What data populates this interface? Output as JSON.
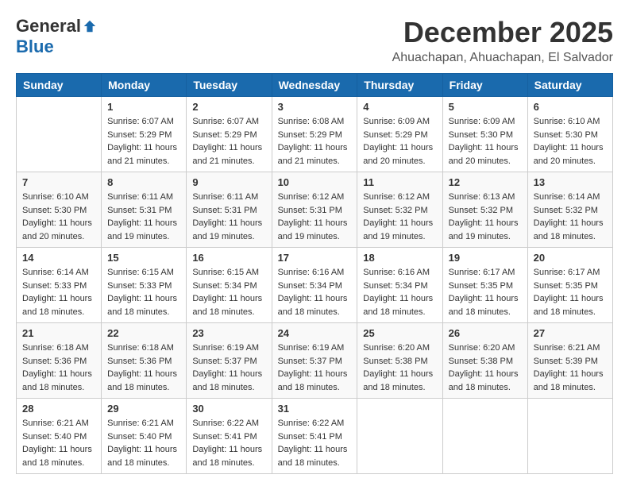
{
  "logo": {
    "general": "General",
    "blue": "Blue"
  },
  "title": {
    "month": "December 2025",
    "location": "Ahuachapan, Ahuachapan, El Salvador"
  },
  "headers": [
    "Sunday",
    "Monday",
    "Tuesday",
    "Wednesday",
    "Thursday",
    "Friday",
    "Saturday"
  ],
  "weeks": [
    [
      {
        "day": "",
        "sunrise": "",
        "sunset": "",
        "daylight": ""
      },
      {
        "day": "1",
        "sunrise": "Sunrise: 6:07 AM",
        "sunset": "Sunset: 5:29 PM",
        "daylight": "Daylight: 11 hours and 21 minutes."
      },
      {
        "day": "2",
        "sunrise": "Sunrise: 6:07 AM",
        "sunset": "Sunset: 5:29 PM",
        "daylight": "Daylight: 11 hours and 21 minutes."
      },
      {
        "day": "3",
        "sunrise": "Sunrise: 6:08 AM",
        "sunset": "Sunset: 5:29 PM",
        "daylight": "Daylight: 11 hours and 21 minutes."
      },
      {
        "day": "4",
        "sunrise": "Sunrise: 6:09 AM",
        "sunset": "Sunset: 5:29 PM",
        "daylight": "Daylight: 11 hours and 20 minutes."
      },
      {
        "day": "5",
        "sunrise": "Sunrise: 6:09 AM",
        "sunset": "Sunset: 5:30 PM",
        "daylight": "Daylight: 11 hours and 20 minutes."
      },
      {
        "day": "6",
        "sunrise": "Sunrise: 6:10 AM",
        "sunset": "Sunset: 5:30 PM",
        "daylight": "Daylight: 11 hours and 20 minutes."
      }
    ],
    [
      {
        "day": "7",
        "sunrise": "Sunrise: 6:10 AM",
        "sunset": "Sunset: 5:30 PM",
        "daylight": "Daylight: 11 hours and 20 minutes."
      },
      {
        "day": "8",
        "sunrise": "Sunrise: 6:11 AM",
        "sunset": "Sunset: 5:31 PM",
        "daylight": "Daylight: 11 hours and 19 minutes."
      },
      {
        "day": "9",
        "sunrise": "Sunrise: 6:11 AM",
        "sunset": "Sunset: 5:31 PM",
        "daylight": "Daylight: 11 hours and 19 minutes."
      },
      {
        "day": "10",
        "sunrise": "Sunrise: 6:12 AM",
        "sunset": "Sunset: 5:31 PM",
        "daylight": "Daylight: 11 hours and 19 minutes."
      },
      {
        "day": "11",
        "sunrise": "Sunrise: 6:12 AM",
        "sunset": "Sunset: 5:32 PM",
        "daylight": "Daylight: 11 hours and 19 minutes."
      },
      {
        "day": "12",
        "sunrise": "Sunrise: 6:13 AM",
        "sunset": "Sunset: 5:32 PM",
        "daylight": "Daylight: 11 hours and 19 minutes."
      },
      {
        "day": "13",
        "sunrise": "Sunrise: 6:14 AM",
        "sunset": "Sunset: 5:32 PM",
        "daylight": "Daylight: 11 hours and 18 minutes."
      }
    ],
    [
      {
        "day": "14",
        "sunrise": "Sunrise: 6:14 AM",
        "sunset": "Sunset: 5:33 PM",
        "daylight": "Daylight: 11 hours and 18 minutes."
      },
      {
        "day": "15",
        "sunrise": "Sunrise: 6:15 AM",
        "sunset": "Sunset: 5:33 PM",
        "daylight": "Daylight: 11 hours and 18 minutes."
      },
      {
        "day": "16",
        "sunrise": "Sunrise: 6:15 AM",
        "sunset": "Sunset: 5:34 PM",
        "daylight": "Daylight: 11 hours and 18 minutes."
      },
      {
        "day": "17",
        "sunrise": "Sunrise: 6:16 AM",
        "sunset": "Sunset: 5:34 PM",
        "daylight": "Daylight: 11 hours and 18 minutes."
      },
      {
        "day": "18",
        "sunrise": "Sunrise: 6:16 AM",
        "sunset": "Sunset: 5:34 PM",
        "daylight": "Daylight: 11 hours and 18 minutes."
      },
      {
        "day": "19",
        "sunrise": "Sunrise: 6:17 AM",
        "sunset": "Sunset: 5:35 PM",
        "daylight": "Daylight: 11 hours and 18 minutes."
      },
      {
        "day": "20",
        "sunrise": "Sunrise: 6:17 AM",
        "sunset": "Sunset: 5:35 PM",
        "daylight": "Daylight: 11 hours and 18 minutes."
      }
    ],
    [
      {
        "day": "21",
        "sunrise": "Sunrise: 6:18 AM",
        "sunset": "Sunset: 5:36 PM",
        "daylight": "Daylight: 11 hours and 18 minutes."
      },
      {
        "day": "22",
        "sunrise": "Sunrise: 6:18 AM",
        "sunset": "Sunset: 5:36 PM",
        "daylight": "Daylight: 11 hours and 18 minutes."
      },
      {
        "day": "23",
        "sunrise": "Sunrise: 6:19 AM",
        "sunset": "Sunset: 5:37 PM",
        "daylight": "Daylight: 11 hours and 18 minutes."
      },
      {
        "day": "24",
        "sunrise": "Sunrise: 6:19 AM",
        "sunset": "Sunset: 5:37 PM",
        "daylight": "Daylight: 11 hours and 18 minutes."
      },
      {
        "day": "25",
        "sunrise": "Sunrise: 6:20 AM",
        "sunset": "Sunset: 5:38 PM",
        "daylight": "Daylight: 11 hours and 18 minutes."
      },
      {
        "day": "26",
        "sunrise": "Sunrise: 6:20 AM",
        "sunset": "Sunset: 5:38 PM",
        "daylight": "Daylight: 11 hours and 18 minutes."
      },
      {
        "day": "27",
        "sunrise": "Sunrise: 6:21 AM",
        "sunset": "Sunset: 5:39 PM",
        "daylight": "Daylight: 11 hours and 18 minutes."
      }
    ],
    [
      {
        "day": "28",
        "sunrise": "Sunrise: 6:21 AM",
        "sunset": "Sunset: 5:40 PM",
        "daylight": "Daylight: 11 hours and 18 minutes."
      },
      {
        "day": "29",
        "sunrise": "Sunrise: 6:21 AM",
        "sunset": "Sunset: 5:40 PM",
        "daylight": "Daylight: 11 hours and 18 minutes."
      },
      {
        "day": "30",
        "sunrise": "Sunrise: 6:22 AM",
        "sunset": "Sunset: 5:41 PM",
        "daylight": "Daylight: 11 hours and 18 minutes."
      },
      {
        "day": "31",
        "sunrise": "Sunrise: 6:22 AM",
        "sunset": "Sunset: 5:41 PM",
        "daylight": "Daylight: 11 hours and 18 minutes."
      },
      {
        "day": "",
        "sunrise": "",
        "sunset": "",
        "daylight": ""
      },
      {
        "day": "",
        "sunrise": "",
        "sunset": "",
        "daylight": ""
      },
      {
        "day": "",
        "sunrise": "",
        "sunset": "",
        "daylight": ""
      }
    ]
  ]
}
